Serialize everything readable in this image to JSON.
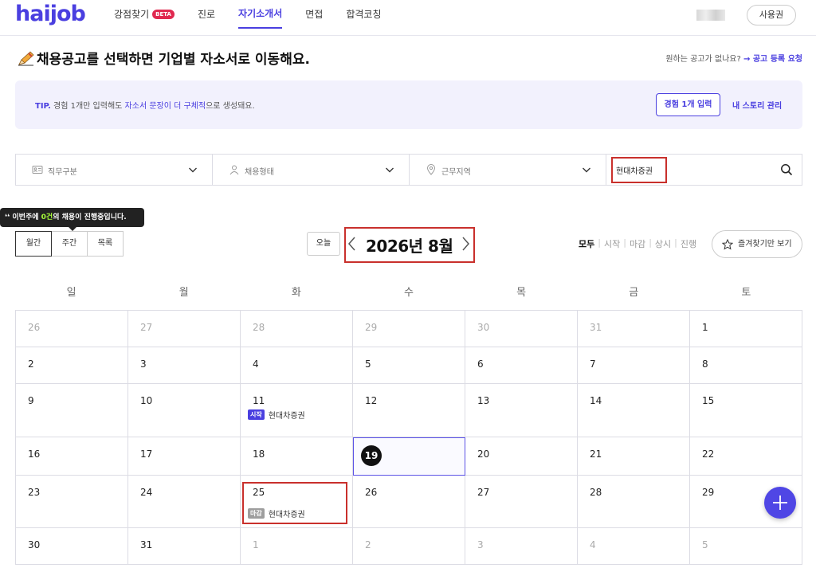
{
  "header": {
    "logo": "haijob",
    "nav": [
      {
        "label": "강점찾기",
        "badge": "BETA"
      },
      {
        "label": "진로"
      },
      {
        "label": "자기소개서",
        "active": true
      },
      {
        "label": "면접"
      },
      {
        "label": "합격코칭"
      }
    ],
    "voucher_button": "사용권"
  },
  "page": {
    "title": "채용공고를 선택하면 기업별 자소서로 이동해요.",
    "request_prefix": "원하는 공고가 없나요?",
    "request_link": "→ 공고 등록 요청"
  },
  "tip": {
    "label": "TIP.",
    "text_1": "경험 1개만 입력해도",
    "highlight": "자소서 문장이 더 구체적",
    "text_2": "으로 생성돼요.",
    "button": "경험 1개 입력",
    "link": "내 스토리 관리"
  },
  "filters": {
    "job": "직무구분",
    "employment": "채용형태",
    "region": "근무지역",
    "search_value": "현대차증권"
  },
  "tooltip": {
    "prefix": "이번주에",
    "count": "0건",
    "suffix": "의 채용이 진행중입니다."
  },
  "views": [
    "월간",
    "주간",
    "목록"
  ],
  "today_button": "오늘",
  "month_label": "2026년 8월",
  "status_filters": [
    "모두",
    "시작",
    "마감",
    "상시",
    "진행"
  ],
  "favorites_button": "즐겨찾기만 보기",
  "weekdays": [
    "일",
    "월",
    "화",
    "수",
    "목",
    "금",
    "토"
  ],
  "weeks": [
    [
      {
        "d": "26",
        "dim": true
      },
      {
        "d": "27",
        "dim": true
      },
      {
        "d": "28",
        "dim": true
      },
      {
        "d": "29",
        "dim": true
      },
      {
        "d": "30",
        "dim": true
      },
      {
        "d": "31",
        "dim": true
      },
      {
        "d": "1"
      }
    ],
    [
      {
        "d": "2"
      },
      {
        "d": "3"
      },
      {
        "d": "4"
      },
      {
        "d": "5"
      },
      {
        "d": "6"
      },
      {
        "d": "7"
      },
      {
        "d": "8"
      }
    ],
    [
      {
        "d": "9"
      },
      {
        "d": "10"
      },
      {
        "d": "11",
        "event": {
          "badge": "시작",
          "type": "start",
          "name": "현대차증권"
        }
      },
      {
        "d": "12"
      },
      {
        "d": "13"
      },
      {
        "d": "14"
      },
      {
        "d": "15"
      }
    ],
    [
      {
        "d": "16"
      },
      {
        "d": "17"
      },
      {
        "d": "18"
      },
      {
        "d": "19",
        "today": true
      },
      {
        "d": "20"
      },
      {
        "d": "21"
      },
      {
        "d": "22"
      }
    ],
    [
      {
        "d": "23"
      },
      {
        "d": "24"
      },
      {
        "d": "25",
        "event": {
          "badge": "마감",
          "type": "end",
          "name": "현대차증권"
        }
      },
      {
        "d": "26"
      },
      {
        "d": "27"
      },
      {
        "d": "28"
      },
      {
        "d": "29"
      }
    ],
    [
      {
        "d": "30"
      },
      {
        "d": "31"
      },
      {
        "d": "1",
        "dim": true
      },
      {
        "d": "2",
        "dim": true
      },
      {
        "d": "3",
        "dim": true
      },
      {
        "d": "4",
        "dim": true
      },
      {
        "d": "5",
        "dim": true
      }
    ]
  ],
  "colors": {
    "accent": "#4a3fe0",
    "highlight_box": "#c9302c",
    "start_badge": "#4a3fe0",
    "end_badge": "#9e9e9e"
  }
}
